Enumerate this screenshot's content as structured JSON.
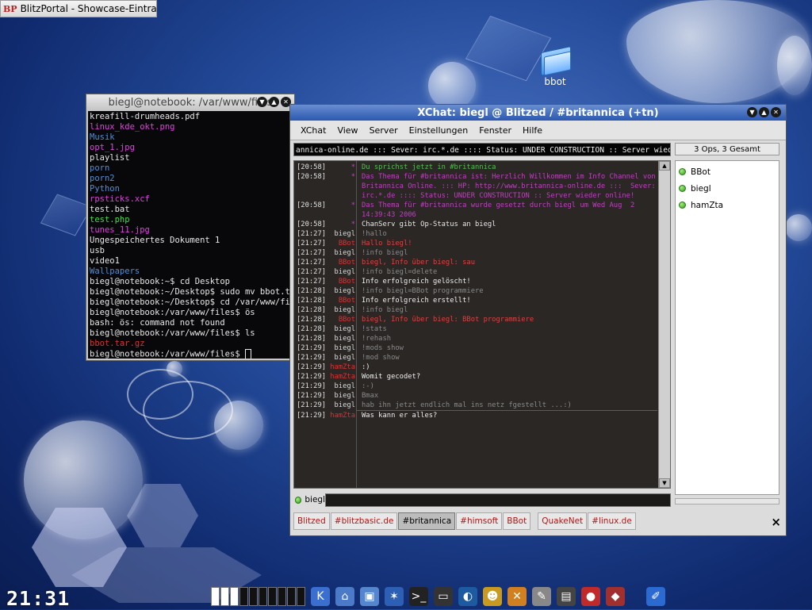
{
  "taskbar_top": {
    "logo": "BP",
    "title": "BlitzPortal - Showcase-Eintrag"
  },
  "desktop_icon": {
    "label": "bbot"
  },
  "terminal": {
    "title": "biegl@notebook: /var/www/files",
    "lines": [
      {
        "text": "kreafill-drumheads.pdf",
        "color": "#e8e8e8"
      },
      {
        "text": "linux_kde_okt.png",
        "color": "#e040e0"
      },
      {
        "text": "Musik",
        "color": "#4f8fd6"
      },
      {
        "text": "opt_1.jpg",
        "color": "#e040e0"
      },
      {
        "text": "playlist",
        "color": "#e8e8e8"
      },
      {
        "text": "porn",
        "color": "#4f8fd6"
      },
      {
        "text": "porn2",
        "color": "#4f8fd6"
      },
      {
        "text": "Python",
        "color": "#4f8fd6"
      },
      {
        "text": "rpsticks.xcf",
        "color": "#e040e0"
      },
      {
        "text": "test.bat",
        "color": "#e8e8e8"
      },
      {
        "text": "test.php",
        "color": "#40e040"
      },
      {
        "text": "tunes_11.jpg",
        "color": "#e040e0"
      },
      {
        "text": "Ungespeichertes Dokument 1",
        "color": "#e8e8e8"
      },
      {
        "text": "usb",
        "color": "#e8e8e8"
      },
      {
        "text": "video1",
        "color": "#e8e8e8"
      },
      {
        "text": "Wallpapers",
        "color": "#4f8fd6"
      },
      {
        "text": "biegl@notebook:~$ cd Desktop",
        "color": "#e8e8e8"
      },
      {
        "text": "biegl@notebook:~/Desktop$ sudo mv bbot.tar",
        "color": "#e8e8e8"
      },
      {
        "text": "biegl@notebook:~/Desktop$ cd /var/www/files",
        "color": "#e8e8e8"
      },
      {
        "text": "biegl@notebook:/var/www/files$ ös",
        "color": "#e8e8e8"
      },
      {
        "text": "bash: ös: command not found",
        "color": "#e8e8e8"
      },
      {
        "text": "biegl@notebook:/var/www/files$ ls",
        "color": "#e8e8e8"
      },
      {
        "text": "bbot.tar.gz",
        "color": "#e03030"
      },
      {
        "text": "biegl@notebook:/var/www/files$ ",
        "color": "#e8e8e8"
      }
    ]
  },
  "xchat": {
    "title": "XChat: biegl @ Blitzed / #britannica (+tn)",
    "menu": [
      "XChat",
      "View",
      "Server",
      "Einstellungen",
      "Fenster",
      "Hilfe"
    ],
    "topic": "annica-online.de :::  Sever: irc.*.de :::: Status: UNDER CONSTRUCTION :: Server wieder online!",
    "ops_count": "3 Ops, 3 Gesamt",
    "users": [
      "BBot",
      "biegl",
      "hamZta"
    ],
    "nick": "biegl",
    "input_value": "",
    "messages": [
      {
        "ts": "[20:58]",
        "nick": "*",
        "nc": "#c040c0",
        "text": "Du sprichst jetzt in #britannica",
        "tc": "#50c050"
      },
      {
        "ts": "[20:58]",
        "nick": "*",
        "nc": "#c040c0",
        "text": "Das Thema für #britannica ist: Herzlich Willkommen im Info Channel von Britannica Online. ::: HP: http://www.britannica-online.de :::  Sever: irc.*.de :::: Status: UNDER CONSTRUCTION :: Server wieder online!",
        "tc": "#c040c0"
      },
      {
        "ts": "[20:58]",
        "nick": "*",
        "nc": "#c040c0",
        "text": "Das Thema für #britannica wurde gesetzt durch biegl um Wed Aug  2 14:39:43 2006",
        "tc": "#c040c0"
      },
      {
        "ts": "[20:58]",
        "nick": "*",
        "nc": "#c040c0",
        "text": "ChanServ gibt Op-Status an biegl",
        "tc": "#e8e8e8"
      },
      {
        "ts": "[21:27]",
        "nick": "biegl",
        "nc": "#d8d8d8",
        "text": "!hallo",
        "tc": "#8a8a8a"
      },
      {
        "ts": "[21:27]",
        "nick": "BBot",
        "nc": "#e03030",
        "text": "Hallo biegl!",
        "tc": "#e04040"
      },
      {
        "ts": "[21:27]",
        "nick": "biegl",
        "nc": "#d8d8d8",
        "text": "!info biegl",
        "tc": "#8a8a8a"
      },
      {
        "ts": "[21:27]",
        "nick": "BBot",
        "nc": "#e03030",
        "text": "biegl, Info über biegl: sau",
        "tc": "#e04040"
      },
      {
        "ts": "[21:27]",
        "nick": "biegl",
        "nc": "#d8d8d8",
        "text": "!info biegl=delete",
        "tc": "#8a8a8a"
      },
      {
        "ts": "[21:27]",
        "nick": "BBot",
        "nc": "#e03030",
        "text": "Info erfolgreich gelöscht!",
        "tc": "#f0f0f0"
      },
      {
        "ts": "[21:28]",
        "nick": "biegl",
        "nc": "#d8d8d8",
        "text": "!info biegl=BBot programmiere",
        "tc": "#8a8a8a"
      },
      {
        "ts": "[21:28]",
        "nick": "BBot",
        "nc": "#e03030",
        "text": "Info erfolgreich erstellt!",
        "tc": "#f0f0f0"
      },
      {
        "ts": "[21:28]",
        "nick": "biegl",
        "nc": "#d8d8d8",
        "text": "!info biegl",
        "tc": "#8a8a8a"
      },
      {
        "ts": "[21:28]",
        "nick": "BBot",
        "nc": "#e03030",
        "text": "biegl, Info über biegl: BBot programmiere",
        "tc": "#e04040"
      },
      {
        "ts": "[21:28]",
        "nick": "biegl",
        "nc": "#d8d8d8",
        "text": "!stats",
        "tc": "#8a8a8a"
      },
      {
        "ts": "[21:28]",
        "nick": "biegl",
        "nc": "#d8d8d8",
        "text": "!rehash",
        "tc": "#8a8a8a"
      },
      {
        "ts": "[21:29]",
        "nick": "biegl",
        "nc": "#d8d8d8",
        "text": "!mods show",
        "tc": "#8a8a8a"
      },
      {
        "ts": "[21:29]",
        "nick": "biegl",
        "nc": "#d8d8d8",
        "text": "!mod show",
        "tc": "#8a8a8a"
      },
      {
        "ts": "[21:29]",
        "nick": "hamZta",
        "nc": "#e03030",
        "text": ":)",
        "tc": "#f0f0f0"
      },
      {
        "ts": "[21:29]",
        "nick": "hamZta",
        "nc": "#e03030",
        "text": "Womit gecodet?",
        "tc": "#f0f0f0"
      },
      {
        "ts": "[21:29]",
        "nick": "biegl",
        "nc": "#d8d8d8",
        "text": ":-)",
        "tc": "#8a8a8a"
      },
      {
        "ts": "[21:29]",
        "nick": "biegl",
        "nc": "#d8d8d8",
        "text": "Bmax",
        "tc": "#8a8a8a"
      },
      {
        "ts": "[21:29]",
        "nick": "biegl",
        "nc": "#d8d8d8",
        "text": "hab ihn jetzt endlich mal ins netz fgestellt ...:)",
        "tc": "#8a8a8a"
      },
      {
        "ts": "[21:29]",
        "nick": "hamZta",
        "nc": "#e03030",
        "text": "Was kann er alles?",
        "tc": "#f0f0f0"
      }
    ],
    "tabs": [
      {
        "label": "Blitzed",
        "active": false,
        "gap_after": false
      },
      {
        "label": "#blitzbasic.de",
        "active": false,
        "gap_after": false
      },
      {
        "label": "#britannica",
        "active": true,
        "gap_after": false
      },
      {
        "label": "#himsoft",
        "active": false,
        "gap_after": false
      },
      {
        "label": "BBot",
        "active": false,
        "gap_after": true
      },
      {
        "label": "QuakeNet",
        "active": false,
        "gap_after": false
      },
      {
        "label": "#linux.de",
        "active": false,
        "gap_after": false
      }
    ],
    "close_glyph": "×"
  },
  "panel": {
    "clock": "21:31",
    "desktops_count": 10,
    "active_desktops": [
      0,
      1,
      2
    ],
    "launcher_icons": [
      {
        "name": "kmenu-icon",
        "glyph": "K",
        "bg": "#3a6fd0"
      },
      {
        "name": "konqueror-icon",
        "glyph": "⌂",
        "bg": "#4a7ac8"
      },
      {
        "name": "network-icon",
        "glyph": "▣",
        "bg": "#5585cc"
      },
      {
        "name": "settings-icon",
        "glyph": "✶",
        "bg": "#2d5fb5"
      },
      {
        "name": "terminal-icon",
        "glyph": ">_",
        "bg": "#222222"
      },
      {
        "name": "monitor-icon",
        "glyph": "▭",
        "bg": "#333333"
      },
      {
        "name": "browser-icon",
        "glyph": "◐",
        "bg": "#1d5aa0"
      },
      {
        "name": "user-icon",
        "glyph": "☻",
        "bg": "#c89a20"
      },
      {
        "name": "tools-icon",
        "glyph": "✕",
        "bg": "#d08020"
      },
      {
        "name": "editor-icon",
        "glyph": "✎",
        "bg": "#888888"
      },
      {
        "name": "display-icon",
        "glyph": "▤",
        "bg": "#444444"
      },
      {
        "name": "game-icon",
        "glyph": "●",
        "bg": "#c02a2a"
      },
      {
        "name": "package-icon",
        "glyph": "◆",
        "bg": "#a03030"
      },
      {
        "name": "cleaner-icon",
        "glyph": "✐",
        "bg": "#2b6ad0"
      }
    ]
  }
}
